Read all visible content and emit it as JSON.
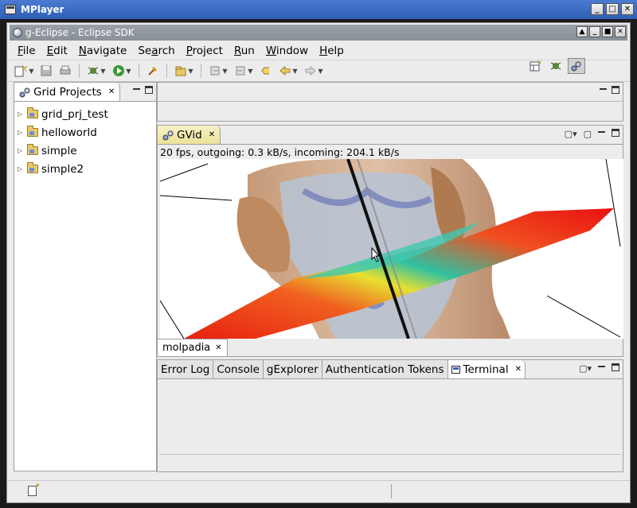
{
  "outer_window": {
    "title": "MPlayer",
    "controls": [
      "_",
      "□",
      "✕"
    ]
  },
  "eclipse": {
    "title": "g-Eclipse - Eclipse SDK",
    "controls": [
      "▲",
      "_",
      "■",
      "✕"
    ],
    "menu": [
      {
        "pre": "",
        "u": "F",
        "post": "ile"
      },
      {
        "pre": "",
        "u": "E",
        "post": "dit"
      },
      {
        "pre": "",
        "u": "N",
        "post": "avigate"
      },
      {
        "pre": "Se",
        "u": "a",
        "post": "rch"
      },
      {
        "pre": "",
        "u": "P",
        "post": "roject"
      },
      {
        "pre": "",
        "u": "R",
        "post": "un"
      },
      {
        "pre": "",
        "u": "W",
        "post": "indow"
      },
      {
        "pre": "",
        "u": "H",
        "post": "elp"
      }
    ]
  },
  "left_panel": {
    "tab_label": "Grid Projects",
    "items": [
      {
        "label": "grid_prj_test"
      },
      {
        "label": "helloworld"
      },
      {
        "label": "simple"
      },
      {
        "label": "simple2"
      }
    ]
  },
  "gvid": {
    "tab_label": "GVid",
    "status": "20 fps, outgoing: 0.3 kB/s, incoming: 204.1 kB/s",
    "sub_tab_label": "molpadia"
  },
  "bottom_panel": {
    "tabs": [
      "Error Log",
      "Console",
      "gExplorer",
      "Authentication Tokens"
    ],
    "active_tab": "Terminal"
  },
  "colors": {
    "title_blue": "#2f5fb5",
    "panel_bg": "#ececec",
    "active_tab_bg": "#ede29a"
  }
}
